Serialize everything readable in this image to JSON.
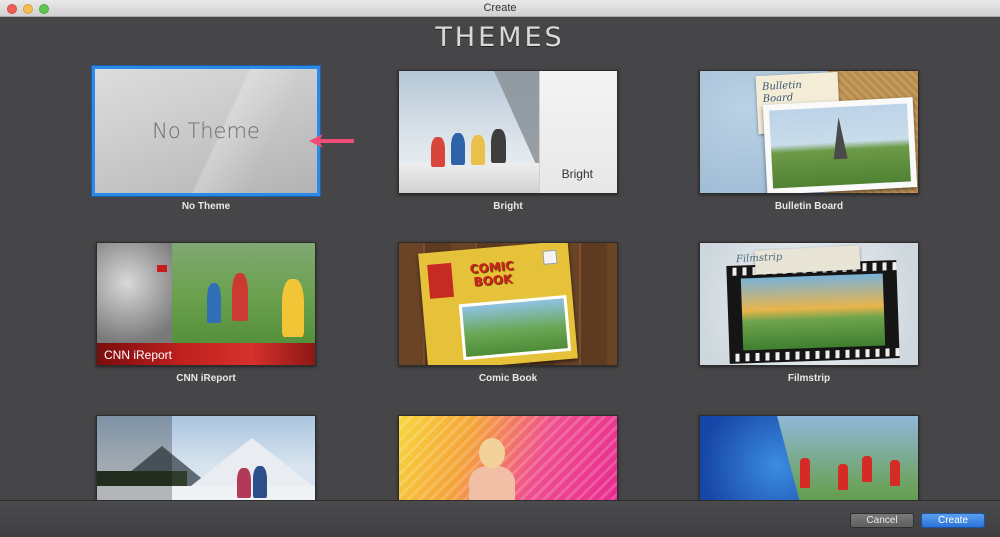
{
  "window": {
    "title": "Create"
  },
  "heading": "THEMES",
  "themes": [
    {
      "label": "No Theme",
      "thumb_text": "No Theme",
      "selected": true
    },
    {
      "label": "Bright",
      "thumb_text": "Bright"
    },
    {
      "label": "Bulletin Board",
      "thumb_text": "Bulletin\nBoard"
    },
    {
      "label": "CNN iReport",
      "thumb_text": "CNN iReport"
    },
    {
      "label": "Comic Book",
      "thumb_text": "COMIC\nBOOK"
    },
    {
      "label": "Filmstrip",
      "thumb_text": "Filmstrip"
    },
    {
      "label": ""
    },
    {
      "label": ""
    },
    {
      "label": ""
    }
  ],
  "buttons": {
    "cancel": "Cancel",
    "create": "Create"
  },
  "colors": {
    "selection": "#2b8ae6",
    "annotation_arrow": "#f04c7a",
    "primary_button": "#2a72d6"
  }
}
